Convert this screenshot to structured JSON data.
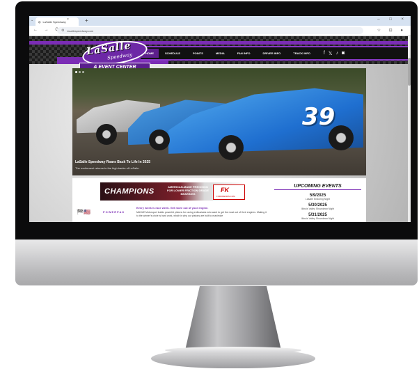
{
  "browser": {
    "tab_title": "LaSalle Speedway",
    "tab_close": "×",
    "new_tab": "+",
    "url": "lasallespeedway.com",
    "nav_buttons": "← → C",
    "window_controls": "– □ ×",
    "right_controls": "☆ ⊡ ●"
  },
  "site": {
    "logo_title": "LaSalle",
    "logo_subtitle": "Speedway",
    "logo_bottom": "& EVENT CENTER",
    "nav": [
      {
        "label": "HOME"
      },
      {
        "label": "SCHEDULE"
      },
      {
        "label": "POINTS"
      },
      {
        "label": "MEDIA"
      },
      {
        "label": "FAN INFO"
      },
      {
        "label": "DRIVER INFO"
      },
      {
        "label": "TRACK INFO"
      }
    ],
    "socials": [
      "f",
      "𝕏",
      "♪",
      "◙"
    ]
  },
  "hero": {
    "car_number": "39",
    "title": "LaSalle Speedway Roars Back To Life In 2025",
    "subtitle": "The excitement returns to the high banks of LaSalle."
  },
  "banner": {
    "headline": "CHAMPIONS",
    "sub": "AMERICAN-MADE PRECISION FOR LOWER FRICTION GRADE BEARINGS",
    "brand": "FK",
    "brand_url": "FKRODENDS.COM"
  },
  "events": {
    "title": "UPCOMING EVENTS",
    "items": [
      {
        "date": "5/9/2025",
        "name": "Lasalle Enduring Night"
      },
      {
        "date": "5/30/2025",
        "name": "Illinois Valley Showdown Night"
      },
      {
        "date": "5/31/2025",
        "name": "Illinois Valley Showdown Night"
      }
    ]
  },
  "sponsor": {
    "powerpak": "POWERPAK",
    "headline": "Every week is race week. Get more out of your engine.",
    "body": "MAHLE Motorsport builds powerful pistons for racing enthusiasts who want to get the most out of their engines. Making it to the winner's circle is hard work, which is why our pistons are built to maximize"
  }
}
